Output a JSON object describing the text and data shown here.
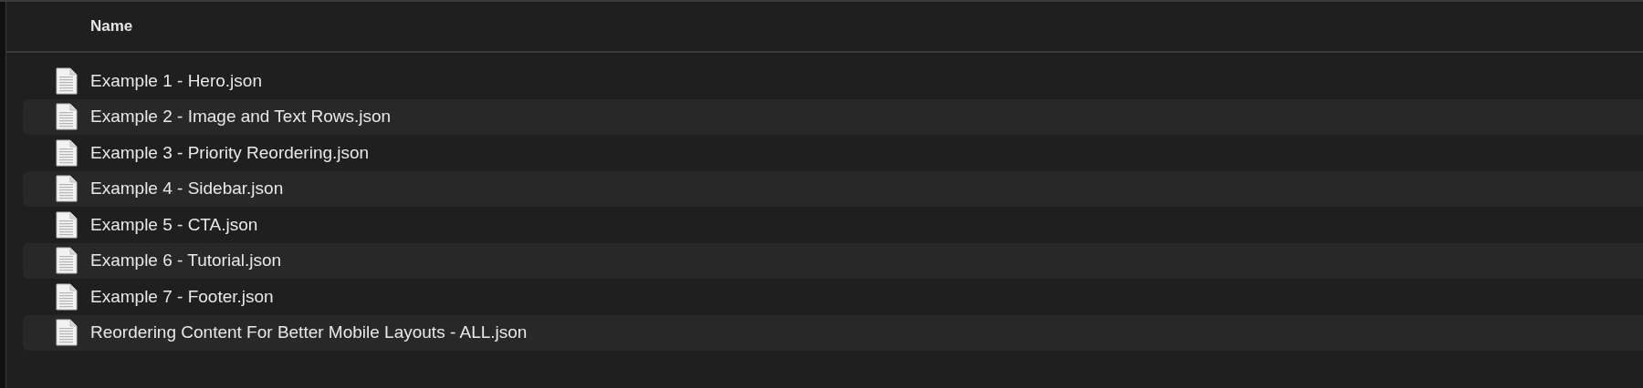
{
  "table": {
    "columns": [
      {
        "label": "Name"
      }
    ],
    "rows": [
      {
        "name": "Example 1 - Hero.json"
      },
      {
        "name": "Example 2 - Image and Text Rows.json"
      },
      {
        "name": "Example 3 - Priority Reordering.json"
      },
      {
        "name": "Example 4 - Sidebar.json"
      },
      {
        "name": "Example 5 - CTA.json"
      },
      {
        "name": "Example 6 - Tutorial.json"
      },
      {
        "name": "Example 7 - Footer.json"
      },
      {
        "name": "Reordering Content For Better Mobile Layouts - ALL.json"
      }
    ]
  }
}
